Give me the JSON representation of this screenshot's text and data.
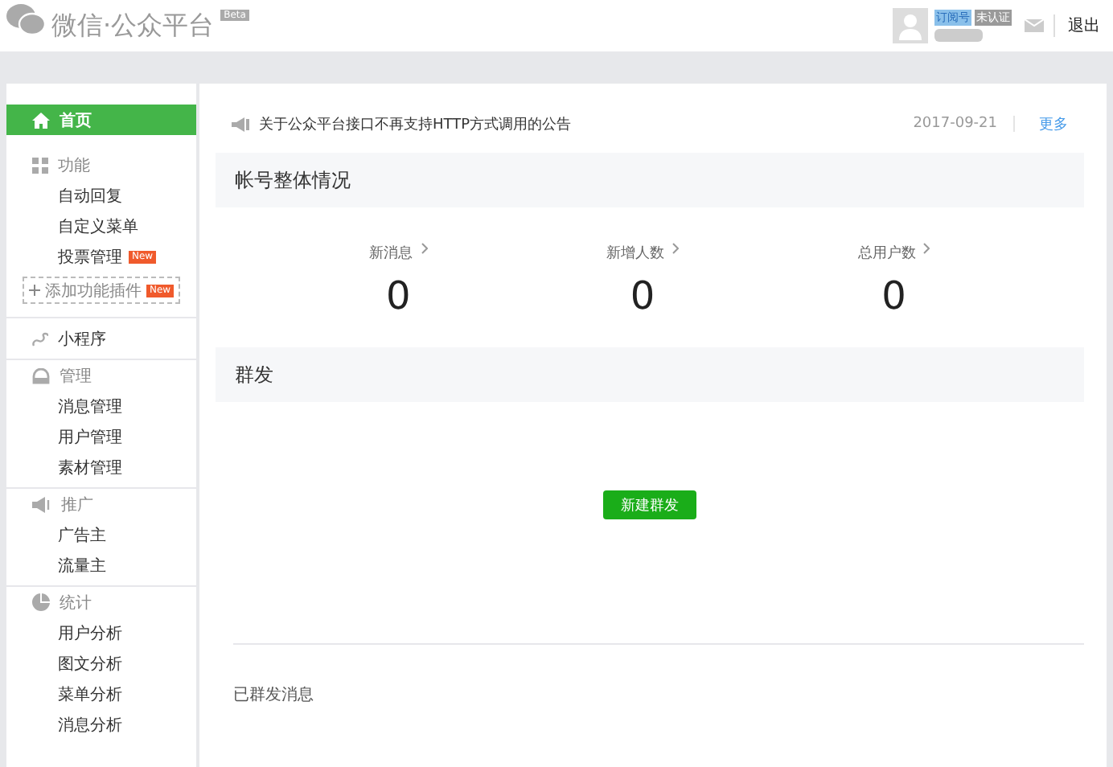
{
  "header": {
    "logo_text": "微信·公众平台",
    "beta_badge": "Beta",
    "account_type": "订阅号",
    "verify_status": "未认证",
    "logout": "退出"
  },
  "sidebar": {
    "sections": [
      {
        "kind": "home",
        "title": "首页",
        "selected": true
      },
      {
        "kind": "features",
        "title": "功能",
        "selected": false,
        "children": [
          {
            "label": "自动回复",
            "selected": false
          },
          {
            "label": "自定义菜单",
            "selected": false
          },
          {
            "label": "投票管理",
            "selected": false,
            "badge": "New"
          }
        ],
        "add_button": {
          "label": "添加功能插件",
          "badge": "New"
        }
      },
      {
        "kind": "miniprogram",
        "title": "小程序",
        "selected": false
      },
      {
        "kind": "manage",
        "title": "管理",
        "selected": false,
        "children": [
          {
            "label": "消息管理",
            "selected": false
          },
          {
            "label": "用户管理",
            "selected": false
          },
          {
            "label": "素材管理",
            "selected": false
          }
        ]
      },
      {
        "kind": "promote",
        "title": "推广",
        "selected": false,
        "children": [
          {
            "label": "广告主",
            "selected": false
          },
          {
            "label": "流量主",
            "selected": false
          }
        ]
      },
      {
        "kind": "stats",
        "title": "统计",
        "selected": false,
        "children": [
          {
            "label": "用户分析",
            "selected": false
          },
          {
            "label": "图文分析",
            "selected": false
          },
          {
            "label": "菜单分析",
            "selected": false
          },
          {
            "label": "消息分析",
            "selected": false
          }
        ]
      }
    ]
  },
  "notice": {
    "text": "关于公众平台接口不再支持HTTP方式调用的公告",
    "date": "2017-09-21",
    "more": "更多"
  },
  "overview": {
    "title": "帐号整体情况",
    "stats": [
      {
        "label": "新消息",
        "value": "0"
      },
      {
        "label": "新增人数",
        "value": "0"
      },
      {
        "label": "总用户数",
        "value": "0"
      }
    ]
  },
  "mass_send": {
    "title": "群发",
    "button": "新建群发",
    "history_title": "已群发消息"
  }
}
